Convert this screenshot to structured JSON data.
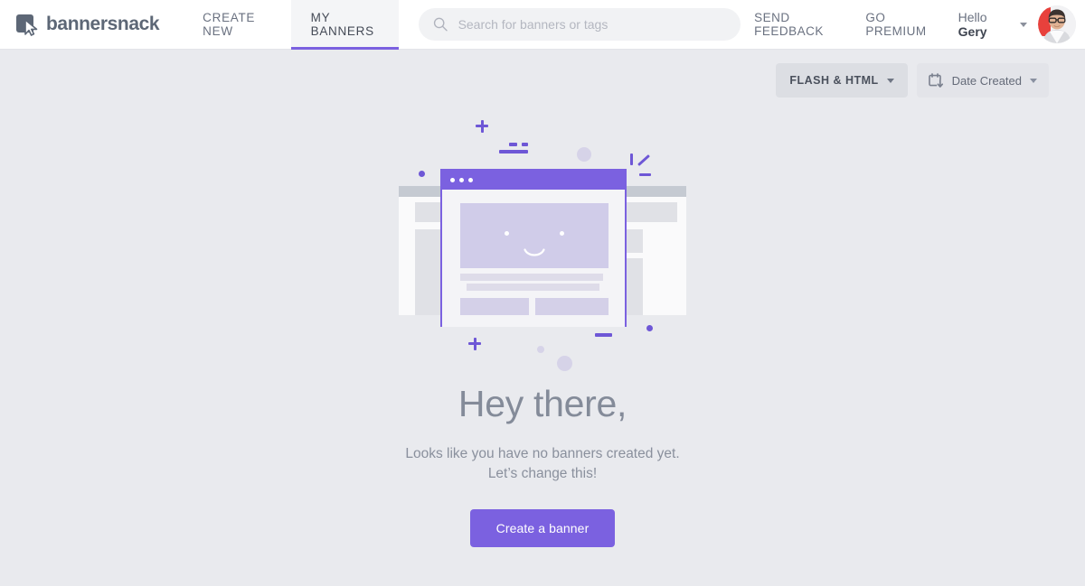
{
  "header": {
    "brand": {
      "name": "bannersnack",
      "icon": "cursor-logo-icon"
    },
    "nav": [
      {
        "id": "create-new",
        "label": "CREATE NEW",
        "active": false
      },
      {
        "id": "my-banners",
        "label": "MY BANNERS",
        "active": true
      }
    ],
    "search": {
      "icon": "search-icon",
      "placeholder": "Search for banners or tags",
      "value": ""
    },
    "links": [
      {
        "id": "send-feedback",
        "label": "SEND FEEDBACK"
      },
      {
        "id": "go-premium",
        "label": "GO PREMIUM"
      }
    ],
    "account": {
      "greeting_prefix": "Hello",
      "user_name": "Gery",
      "caret_icon": "chevron-down-icon",
      "avatar_icon": "user-avatar"
    }
  },
  "toolbar": {
    "type_filter": {
      "label": "FLASH & HTML",
      "caret_icon": "chevron-down-icon"
    },
    "sort_filter": {
      "label": "Date Created",
      "icon": "calendar-sort-icon",
      "caret_icon": "chevron-down-icon"
    }
  },
  "empty_state": {
    "illustration_name": "no-banners-illustration",
    "headline": "Hey there,",
    "line1": "Looks like you have no banners created yet.",
    "line2": "Let’s change this!",
    "cta_label": "Create a banner"
  },
  "colors": {
    "accent": "#7b61e0",
    "accent_deco": "#6e57d6",
    "page_bg": "#e9eaee",
    "header_bg": "#ffffff",
    "tab_active_bg": "#f4f5f7",
    "text_muted": "#8a909d",
    "face_fill": "#d0cce9",
    "wireframe_grey": "#e0e1e6"
  }
}
